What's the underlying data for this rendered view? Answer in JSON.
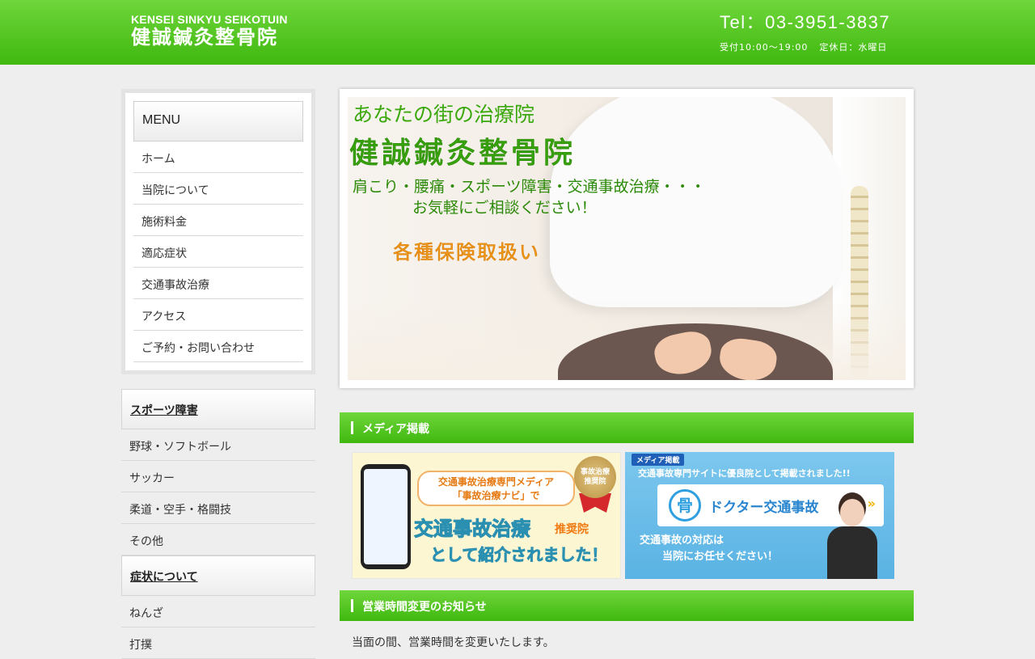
{
  "header": {
    "logo_en": "KENSEI SINKYU SEIKOTUIN",
    "logo_jp": "健誠鍼灸整骨院",
    "tel": "Tel：03-3951-3837",
    "hours": "受付10:00～19:00",
    "closed": "定休日：水曜日"
  },
  "menu": {
    "title": "MENU",
    "items": [
      {
        "label": "ホーム"
      },
      {
        "label": "当院について"
      },
      {
        "label": "施術料金"
      },
      {
        "label": "適応症状"
      },
      {
        "label": "交通事故治療"
      },
      {
        "label": "アクセス"
      },
      {
        "label": "ご予約・お問い合わせ"
      }
    ]
  },
  "categories": [
    {
      "title": "スポーツ障害",
      "items": [
        "野球・ソフトボール",
        "サッカー",
        "柔道・空手・格闘技",
        "その他"
      ]
    },
    {
      "title": "症状について",
      "items": [
        "ねんざ",
        "打撲"
      ]
    }
  ],
  "hero": {
    "subtitle": "あなたの街の治療院",
    "name": "健誠鍼灸整骨院",
    "line1": "肩こり・腰痛・スポーツ障害・交通事故治療・・・",
    "line2": "お気軽にご相談ください！",
    "insurance": "各種保険取扱い"
  },
  "media": {
    "title": "メディア掲載",
    "banner1": {
      "bubble_line1": "交通事故治療専門メディア",
      "bubble_line2": "「事故治療ナビ」で",
      "medal_line1": "事故治療",
      "medal_line2": "推奨院",
      "main": "交通事故治療",
      "tag": "推奨院",
      "sub": "として紹介されました！"
    },
    "banner2": {
      "tag": "メディア掲載",
      "top": "交通事故専門サイトに優良院として掲載されました!!",
      "logo": "骨",
      "brand": "ドクター交通事故",
      "arrow": "»",
      "line1": "交通事故の対応は",
      "line2": "当院にお任せください！"
    }
  },
  "notice": {
    "title": "営業時間変更のお知らせ",
    "text": "当面の間、営業時間を変更いたします。"
  }
}
